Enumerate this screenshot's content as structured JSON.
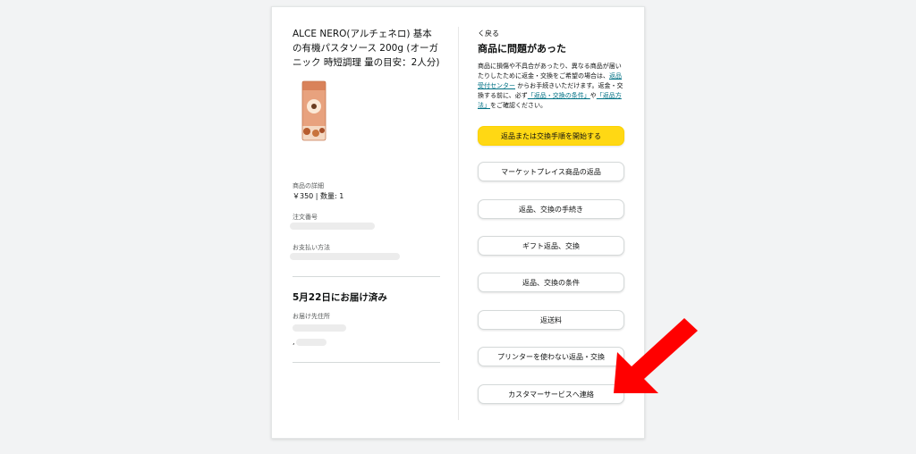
{
  "product": {
    "title": "ALCE NERO(アルチェネロ) 基本の有機パスタソース 200g (オーガニック 時短調理 量の目安：2人分)",
    "details_label": "商品の詳細",
    "price_qty": "￥350 | 数量: 1",
    "order_number_label": "注文番号",
    "payment_label": "お支払い方法"
  },
  "delivery": {
    "status": "5月22日にお届け済み",
    "address_label": "お届け先住所",
    "address_prefix": ","
  },
  "panel": {
    "back": "く戻る",
    "title": "商品に問題があった",
    "desc_1": "商品に損傷や不具合があったり、異なる商品が届いたりしたために返金・交換をご希望の場合は、",
    "link_center": "返品受付センター",
    "desc_2": " からお手続きいただけます。返金・交換する前に、必ず",
    "link_conditions": "「返品・交換の条件」",
    "desc_3": "や",
    "link_method": "「返品方法」",
    "desc_4": "をご確認ください。"
  },
  "buttons": {
    "start": "返品または交換手順を開始する",
    "marketplace": "マーケットプレイス商品の返品",
    "procedure": "返品、交換の手続き",
    "gift": "ギフト返品、交換",
    "conditions": "返品、交換の条件",
    "shipping": "返送料",
    "no_printer": "プリンターを使わない返品・交換",
    "contact": "カスタマーサービスへ連絡"
  },
  "colors": {
    "primary_button": "#ffd814",
    "link": "#007185",
    "annotation_arrow": "#ff0000"
  }
}
